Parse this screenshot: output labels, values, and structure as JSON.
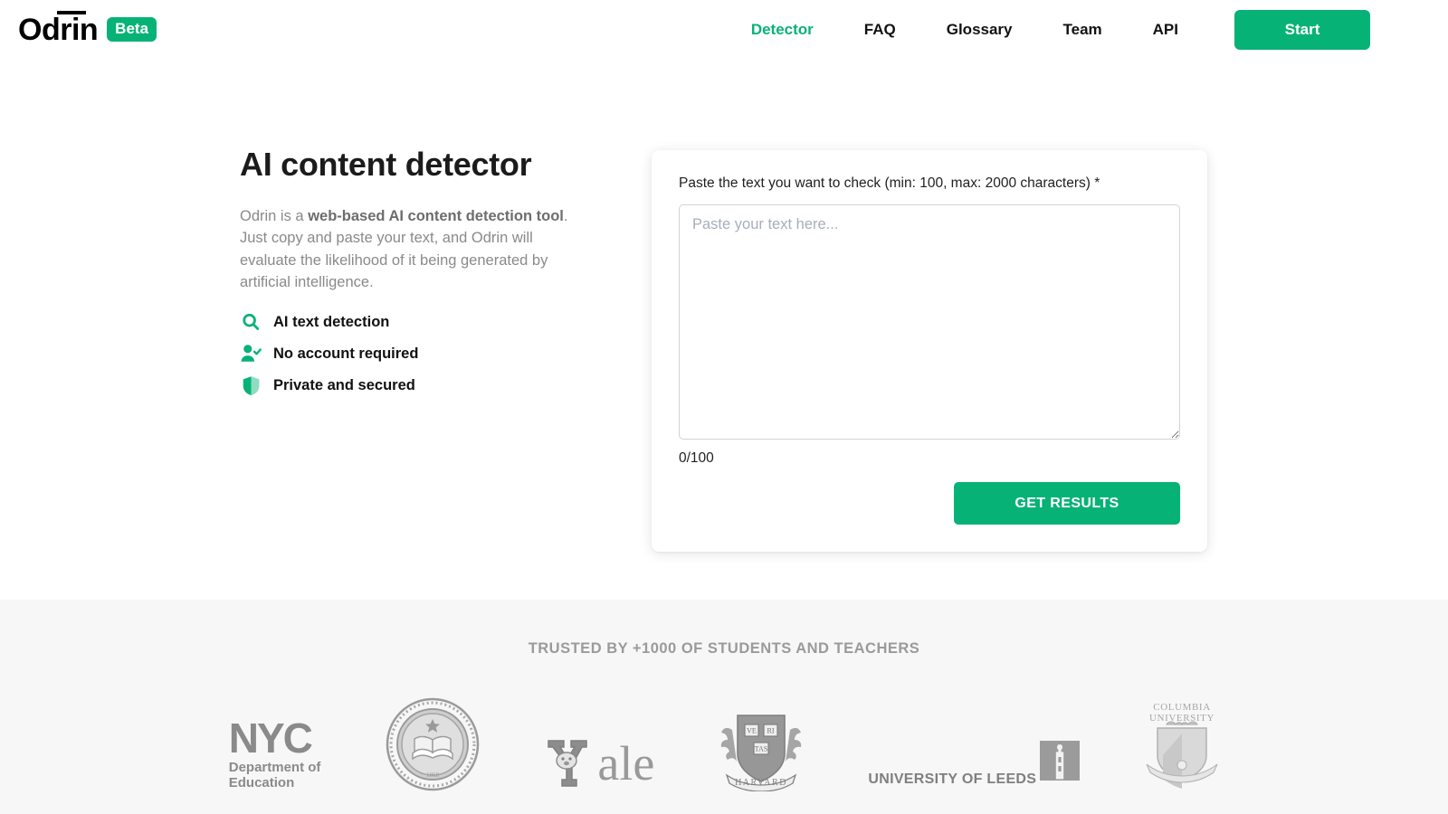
{
  "brand": {
    "name": "Odrin",
    "badge": "Beta",
    "accent_color": "#07b277"
  },
  "nav": {
    "items": [
      {
        "label": "Detector",
        "active": true
      },
      {
        "label": "FAQ",
        "active": false
      },
      {
        "label": "Glossary",
        "active": false
      },
      {
        "label": "Team",
        "active": false
      },
      {
        "label": "API",
        "active": false
      }
    ],
    "cta_label": "Start"
  },
  "hero": {
    "title": "AI content detector",
    "description_before": "Odrin is a ",
    "description_bold": "web-based AI content detection tool",
    "description_after": ". Just copy and paste your text, and Odrin will evaluate the likelihood of it being generated by artificial intelligence.",
    "features": [
      {
        "icon": "search-icon",
        "label": "AI text detection"
      },
      {
        "icon": "user-check-icon",
        "label": "No account required"
      },
      {
        "icon": "shield-icon",
        "label": "Private and secured"
      }
    ]
  },
  "form": {
    "label": "Paste the text you want to check (min: 100, max: 2000 characters) *",
    "placeholder": "Paste your text here...",
    "value": "",
    "counter": "0/100",
    "submit_label": "GET RESULTS"
  },
  "trusted": {
    "title": "TRUSTED BY +1000 OF STUDENTS AND TEACHERS",
    "logos": [
      {
        "name": "nyc-department-of-education-logo",
        "word": "NYC",
        "sub_line1": "Department of",
        "sub_line2": "Education"
      },
      {
        "name": "uc-berkeley-logo",
        "word": "THE UNIVERSITY OF CALIFORNIA BERKELEY",
        "sub_line1": "1868",
        "sub_line2": ""
      },
      {
        "name": "yale-logo",
        "word": "ale",
        "sub_line1": "",
        "sub_line2": ""
      },
      {
        "name": "harvard-logo",
        "word": "VE RI TAS",
        "sub_line1": "HARVARD",
        "sub_line2": ""
      },
      {
        "name": "university-of-leeds-logo",
        "word": "UNIVERSITY OF LEEDS",
        "sub_line1": "",
        "sub_line2": ""
      },
      {
        "name": "columbia-university-logo",
        "word": "COLUMBIA",
        "sub_line1": "UNIVERSITY",
        "sub_line2": ""
      }
    ]
  }
}
